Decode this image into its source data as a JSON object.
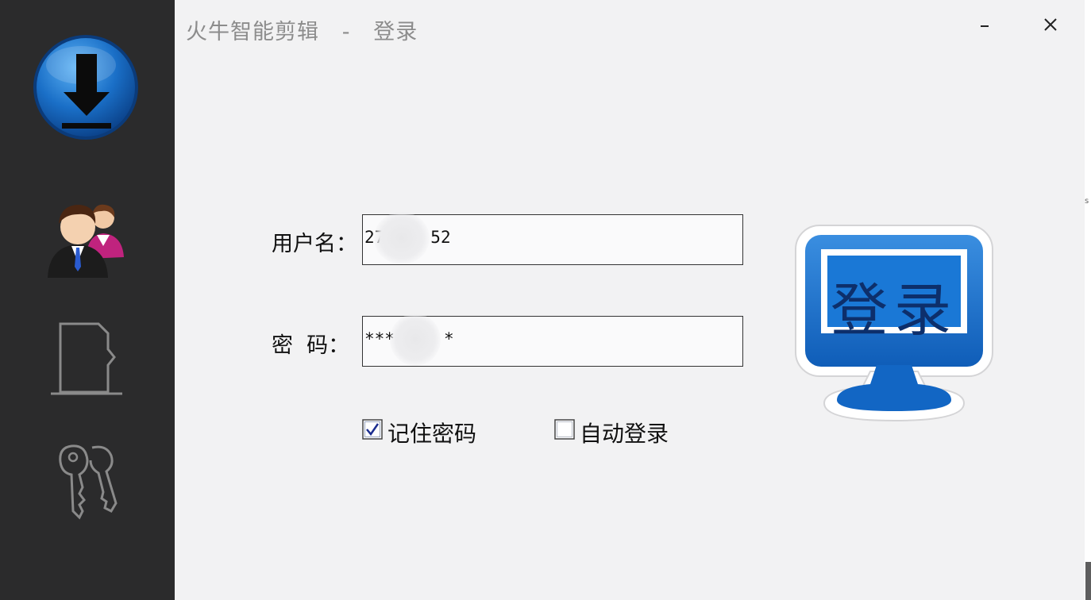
{
  "window": {
    "title": "火牛智能剪辑   -   登录",
    "minimize_icon": "minimize-icon",
    "close_icon": "close-icon"
  },
  "sidebar": {
    "items": [
      {
        "icon": "download-icon"
      },
      {
        "icon": "users-icon"
      },
      {
        "icon": "sd-card-icon"
      },
      {
        "icon": "key-icon"
      }
    ]
  },
  "form": {
    "username_label": "用户名：",
    "username_value_start": "27",
    "username_value_end": "52",
    "password_label": "密  码：",
    "password_value_start": "***",
    "password_value_end": "*",
    "remember_label": "记住密码",
    "remember_checked": true,
    "auto_login_label": "自动登录",
    "auto_login_checked": false
  },
  "login_button": {
    "label": "登录",
    "icon": "monitor-icon"
  },
  "colors": {
    "sidebar_bg": "#2b2b2c",
    "window_bg": "#f2f2f3",
    "accent_blue": "#1a6fc7"
  }
}
